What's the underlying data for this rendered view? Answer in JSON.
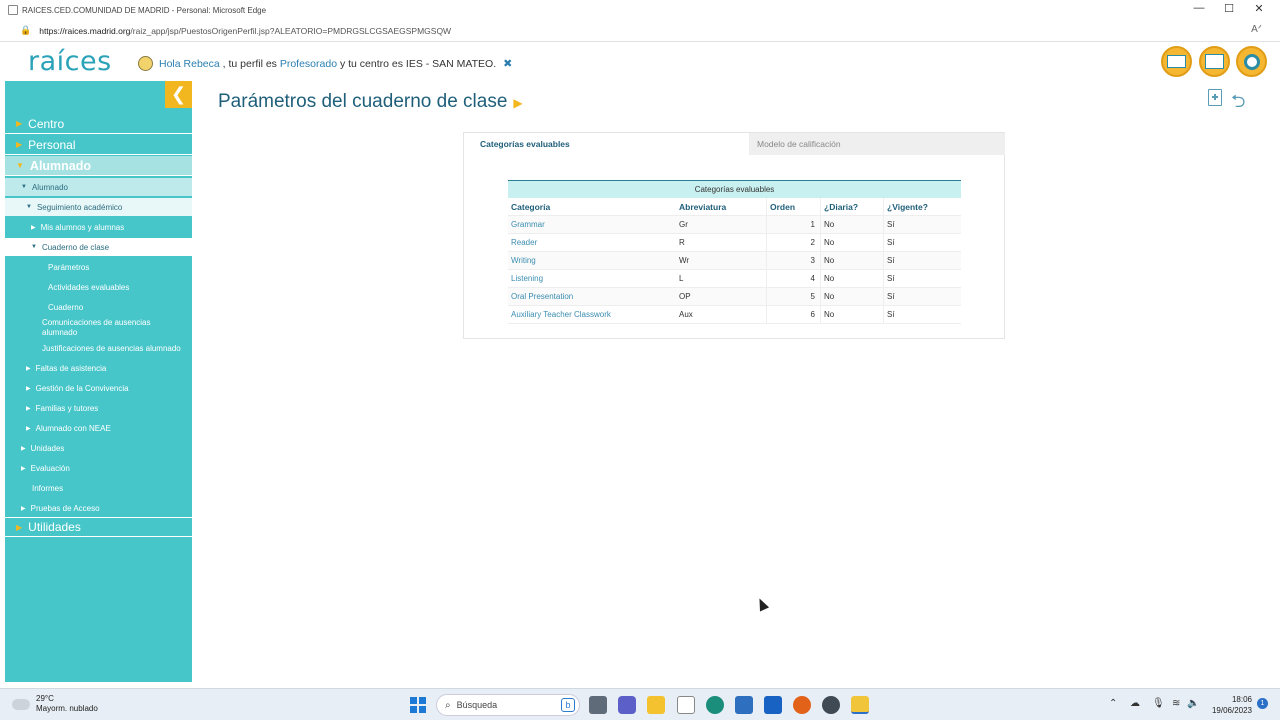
{
  "window": {
    "title": "RAICES.CED.COMUNIDAD DE MADRID - Personal: Microsoft Edge",
    "url_host": "https://raices.madrid.org",
    "url_path": "/raiz_app/jsp/PuestosOrigenPerfil.jsp?ALEATORIO=PMDRGSLCGSAEGSPMGSQW",
    "controls": {
      "minimize": "—",
      "maximize": "☐",
      "close": "✕"
    }
  },
  "header": {
    "logo": "raíces",
    "greeting_prefix": "Hola ",
    "user_name": "Rebeca",
    "greeting_mid": " , tu perfil es ",
    "profile": "Profesorado",
    "greeting_suffix": " y tu centro es IES - SAN MATEO.",
    "close_glyph": "✖"
  },
  "sidebar": {
    "collapse_glyph": "❮",
    "items": [
      {
        "label": "Centro"
      },
      {
        "label": "Personal"
      },
      {
        "label": "Alumnado"
      },
      {
        "label": "Alumnado"
      },
      {
        "label": "Seguimiento académico"
      },
      {
        "label": "Mis alumnos y alumnas"
      },
      {
        "label": "Cuaderno de clase"
      },
      {
        "label": "Parámetros"
      },
      {
        "label": "Actividades evaluables"
      },
      {
        "label": "Cuaderno"
      },
      {
        "label": "Comunicaciones de ausencias alumnado"
      },
      {
        "label": "Justificaciones de ausencias alumnado"
      },
      {
        "label": "Faltas de asistencia"
      },
      {
        "label": "Gestión de la Convivencia"
      },
      {
        "label": "Familias y tutores"
      },
      {
        "label": "Alumnado con NEAE"
      },
      {
        "label": "Unidades"
      },
      {
        "label": "Evaluación"
      },
      {
        "label": "Informes"
      },
      {
        "label": "Pruebas de Acceso"
      },
      {
        "label": "Utilidades"
      }
    ]
  },
  "main": {
    "title": "Parámetros del cuaderno de clase",
    "title_chevron": "›",
    "tabs": [
      {
        "label": "Categorías evaluables"
      },
      {
        "label": "Modelo de calificación"
      }
    ],
    "table": {
      "caption": "Categorías evaluables",
      "columns": [
        "Categoría",
        "Abreviatura",
        "Orden",
        "¿Diaria?",
        "¿Vigente?"
      ],
      "rows": [
        [
          "Grammar",
          "Gr",
          "1",
          "No",
          "Sí"
        ],
        [
          "Reader",
          "R",
          "2",
          "No",
          "Sí"
        ],
        [
          "Writing",
          "Wr",
          "3",
          "No",
          "Sí"
        ],
        [
          "Listening",
          "L",
          "4",
          "No",
          "Sí"
        ],
        [
          "Oral Presentation",
          "OP",
          "5",
          "No",
          "Sí"
        ],
        [
          "Auxiliary Teacher Classwork",
          "Aux",
          "6",
          "No",
          "Sí"
        ]
      ]
    }
  },
  "taskbar": {
    "weather_temp": "29°C",
    "weather_desc": "Mayorm. nublado",
    "search_placeholder": "Búsqueda",
    "time": "18:06",
    "date": "19/06/2023",
    "notif_count": "1"
  }
}
